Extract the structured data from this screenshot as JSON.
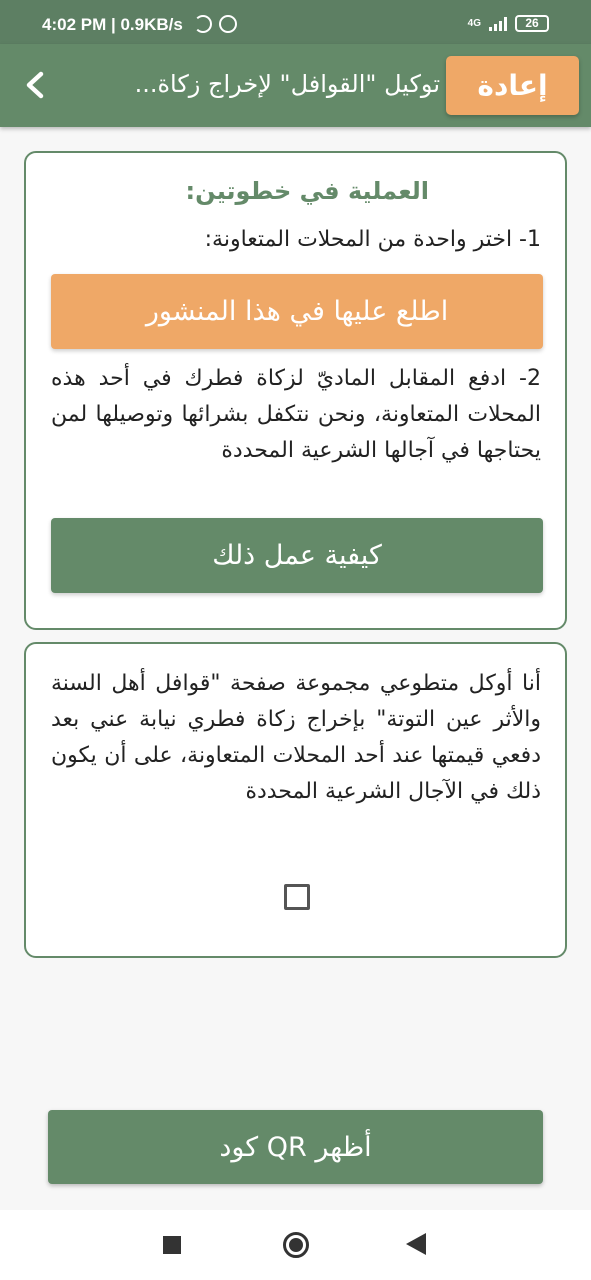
{
  "status": {
    "time": "4:02 PM | 0.9KB/s",
    "network": "4G",
    "battery": "26"
  },
  "app_bar": {
    "title": "توكيل \"القوافل\" لإخراج زكاة...",
    "reset_label": "إعادة",
    "back_icon": "chevron-left-icon"
  },
  "steps": {
    "heading": "العملية في خطوتين:",
    "step_one": "1- اختر واحدة من المحلات المتعاونة:",
    "view_post_label": "اطلع عليها في هذا المنشور",
    "step_two": "2- ادفع المقابل الماديّ لزكاة فطرك في أحد هذه المحلات المتعاونة، ونحن نتكفل بشرائها وتوصيلها لمن يحتاجها في آجالها الشرعية المحددة",
    "how_to_label": "كيفية عمل ذلك"
  },
  "consent": {
    "text": "أنا أوكل متطوعي مجموعة صفحة \"قوافل أهل السنة والأثر عين التوتة\" بإخراج زكاة فطري نيابة عني بعد دفعي قيمتها عند أحد المحلات المتعاونة، على أن يكون ذلك في الآجال الشرعية المحددة",
    "checked": false
  },
  "qr_button_label": "أظهر QR كود",
  "colors": {
    "primary": "#648a69",
    "accent": "#efa867",
    "status_bar": "#5d7f63"
  }
}
